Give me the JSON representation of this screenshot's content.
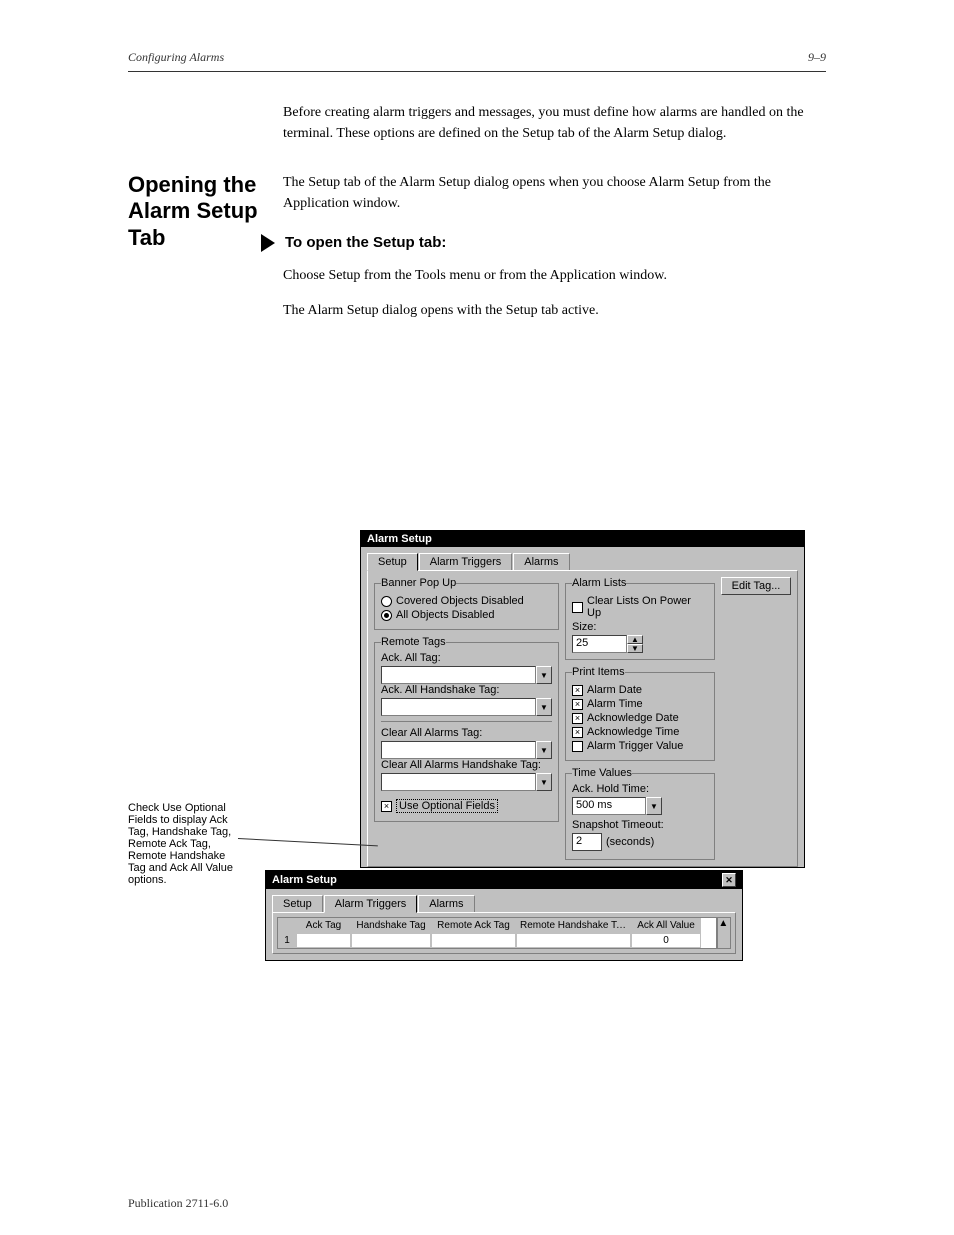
{
  "page": {
    "header_right": "Configuring Alarms",
    "header_left": "9–9",
    "footer_left": "Publication 2711-6.0",
    "intro": "Before creating alarm triggers and messages, you must define how alarms are handled on the terminal. These options are defined on the Setup tab of the Alarm Setup dialog.",
    "section_title": "Opening the Alarm Setup Tab",
    "sec_p1": "The Setup tab of the Alarm Setup dialog opens when you choose Alarm Setup from the Application window.",
    "sec_h1": "To open the Setup tab:",
    "sec_p2": "Choose Setup from the Tools menu or from the Application window.",
    "sec_p3": "The Alarm Setup dialog opens with the Setup tab active.",
    "callout": "Check Use Optional Fields to display Ack Tag, Handshake Tag, Remote Ack Tag, Remote Handshake Tag and Ack All Value options."
  },
  "d1": {
    "title": "Alarm Setup",
    "tabs": [
      "Setup",
      "Alarm Triggers",
      "Alarms"
    ],
    "banner_legend": "Banner Pop Up",
    "radio1": "Covered Objects Disabled",
    "radio2": "All Objects Disabled",
    "remote_legend": "Remote Tags",
    "ack_all_tag": "Ack. All Tag:",
    "ack_all_hand": "Ack. All Handshake Tag:",
    "clear_all": "Clear All Alarms Tag:",
    "clear_all_hand": "Clear All Alarms Handshake Tag:",
    "use_optional": "Use Optional Fields",
    "alarm_lists_legend": "Alarm Lists",
    "clear_lists": "Clear Lists On Power Up",
    "size_lbl": "Size:",
    "size_val": "25",
    "print_legend": "Print Items",
    "pi1": "Alarm Date",
    "pi2": "Alarm Time",
    "pi3": "Acknowledge Date",
    "pi4": "Acknowledge Time",
    "pi5": "Alarm Trigger Value",
    "time_legend": "Time Values",
    "ack_hold": "Ack. Hold Time:",
    "ack_hold_val": "500 ms",
    "snap_lbl": "Snapshot Timeout:",
    "snap_val": "2",
    "snap_unit": "(seconds)",
    "edit_tag": "Edit Tag..."
  },
  "d2": {
    "title": "Alarm Setup",
    "tabs": [
      "Setup",
      "Alarm Triggers",
      "Alarms"
    ],
    "cols": [
      "",
      "Ack Tag",
      "Handshake Tag",
      "Remote Ack Tag",
      "Remote Handshake Tag",
      "Ack All Value"
    ],
    "row1_idx": "1",
    "row1_ackall": "0"
  }
}
